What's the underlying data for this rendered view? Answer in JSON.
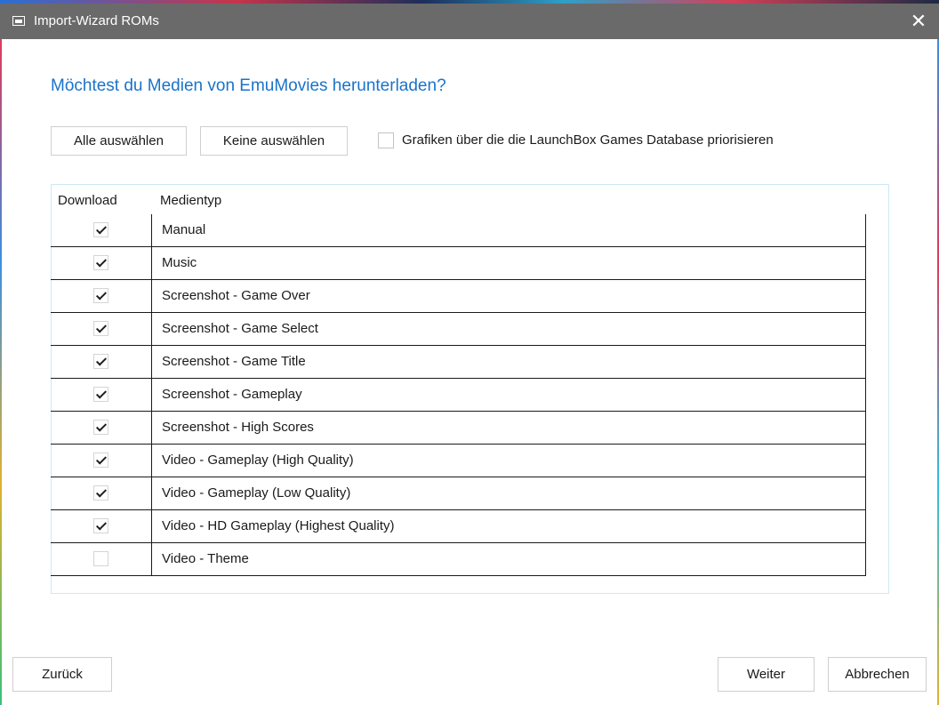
{
  "window": {
    "title": "Import-Wizard ROMs",
    "close_glyph": "✕"
  },
  "heading": "Möchtest du Medien von EmuMovies herunterladen?",
  "toolbar": {
    "select_all": "Alle auswählen",
    "select_none": "Keine auswählen",
    "prioritize_label": "Grafiken über die die LaunchBox Games Database priorisieren",
    "prioritize_checked": false
  },
  "table": {
    "col_download": "Download",
    "col_mediatype": "Medientyp",
    "rows": [
      {
        "label": "Manual",
        "checked": true
      },
      {
        "label": "Music",
        "checked": true
      },
      {
        "label": "Screenshot - Game Over",
        "checked": true
      },
      {
        "label": "Screenshot - Game Select",
        "checked": true
      },
      {
        "label": "Screenshot - Game Title",
        "checked": true
      },
      {
        "label": "Screenshot - Gameplay",
        "checked": true
      },
      {
        "label": "Screenshot - High Scores",
        "checked": true
      },
      {
        "label": "Video - Gameplay (High Quality)",
        "checked": true
      },
      {
        "label": "Video - Gameplay (Low Quality)",
        "checked": true
      },
      {
        "label": "Video - HD Gameplay (Highest Quality)",
        "checked": true
      },
      {
        "label": "Video - Theme",
        "checked": false
      }
    ]
  },
  "footer": {
    "back": "Zurück",
    "next": "Weiter",
    "cancel": "Abbrechen"
  },
  "colors": {
    "titlebar": "#6a6a6a",
    "heading": "#1a73c9",
    "grid_border": "#cde9f6"
  }
}
